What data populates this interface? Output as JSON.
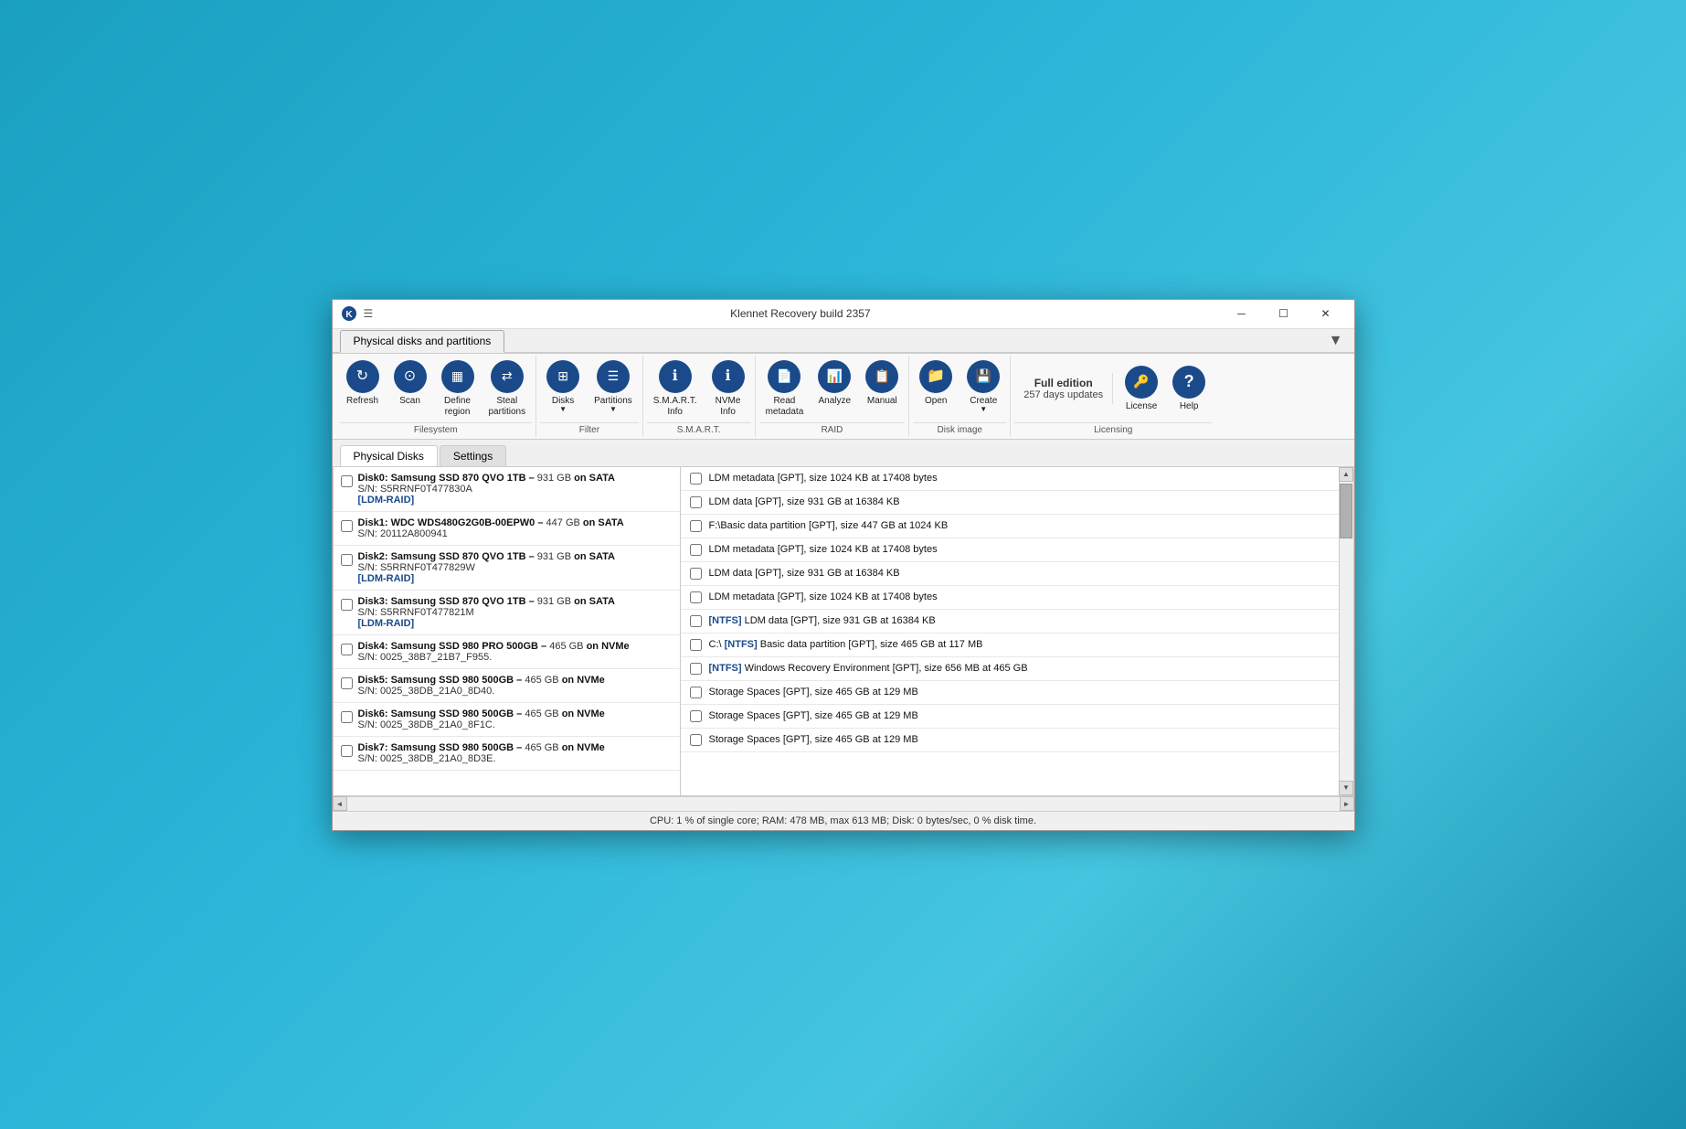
{
  "window": {
    "title": "Klennet Recovery build 2357",
    "tab_label": "Physical disks and partitions",
    "dropdown_arrow": "▼"
  },
  "ribbon": {
    "groups": [
      {
        "name": "filesystem",
        "label": "Filesystem",
        "buttons": [
          {
            "id": "refresh",
            "label": "Refresh",
            "icon": "↻",
            "sublabel": ""
          },
          {
            "id": "scan",
            "label": "Scan",
            "icon": "⊙",
            "sublabel": ""
          },
          {
            "id": "define-region",
            "label": "Define\nregion",
            "icon": "▦",
            "sublabel": ""
          },
          {
            "id": "steal-partitions",
            "label": "Steal\npartitions",
            "icon": "⇄",
            "sublabel": ""
          }
        ]
      },
      {
        "name": "filter",
        "label": "Filter",
        "buttons": [
          {
            "id": "disks",
            "label": "Disks",
            "icon": "⊞",
            "sublabel": "▼",
            "has_arrow": true
          },
          {
            "id": "partitions",
            "label": "Partitions",
            "icon": "☰",
            "sublabel": "▼",
            "has_arrow": true
          }
        ]
      },
      {
        "name": "smart",
        "label": "S.M.A.R.T.",
        "buttons": [
          {
            "id": "smart-info",
            "label": "S.M.A.R.T.\nInfo",
            "icon": "ℹ",
            "sublabel": ""
          },
          {
            "id": "nvme-info",
            "label": "NVMe\nInfo",
            "icon": "ℹ",
            "sublabel": ""
          }
        ]
      },
      {
        "name": "raid",
        "label": "RAID",
        "buttons": [
          {
            "id": "read-metadata",
            "label": "Read\nmetadata",
            "icon": "📄",
            "sublabel": ""
          },
          {
            "id": "analyze",
            "label": "Analyze",
            "icon": "📊",
            "sublabel": ""
          },
          {
            "id": "manual",
            "label": "Manual",
            "icon": "📋",
            "sublabel": ""
          }
        ]
      },
      {
        "name": "disk-image",
        "label": "Disk image",
        "buttons": [
          {
            "id": "open",
            "label": "Open",
            "icon": "📁",
            "sublabel": ""
          },
          {
            "id": "create",
            "label": "Create",
            "icon": "💾",
            "sublabel": "▼",
            "has_arrow": true
          }
        ]
      },
      {
        "name": "licensing",
        "label": "Licensing",
        "full_edition": "Full edition",
        "days_updates": "257 days updates",
        "buttons": [
          {
            "id": "license",
            "label": "License",
            "icon": "🔑",
            "sublabel": ""
          },
          {
            "id": "help",
            "label": "Help",
            "icon": "?",
            "sublabel": ""
          }
        ]
      }
    ]
  },
  "inner_tabs": [
    {
      "id": "physical-disks",
      "label": "Physical Disks",
      "active": true
    },
    {
      "id": "settings",
      "label": "Settings",
      "active": false
    }
  ],
  "disks": [
    {
      "id": "disk0",
      "name": "Disk0:",
      "model": "Samsung SSD 870 QVO 1TB",
      "size": "931 GB",
      "interface": "SATA",
      "serial": "S/N: S5RRNF0T477830A",
      "tag": "[LDM-RAID]",
      "partitions": [
        {
          "text": "LDM metadata [GPT], size 1024 KB at 17408 bytes",
          "ntfs": false
        },
        {
          "text": "LDM data [GPT], size 931 GB at 16384 KB",
          "ntfs": false
        }
      ]
    },
    {
      "id": "disk1",
      "name": "Disk1:",
      "model": "WDC WDS480G2G0B-00EPW0",
      "size": "447 GB",
      "interface": "SATA",
      "serial": "S/N: 20112A800941",
      "tag": "",
      "partitions": [
        {
          "text": "F:\\ Basic data partition [GPT], size 447 GB at 1024 KB",
          "ntfs": false,
          "prefix": "F:\\"
        }
      ]
    },
    {
      "id": "disk2",
      "name": "Disk2:",
      "model": "Samsung SSD 870 QVO 1TB",
      "size": "931 GB",
      "interface": "SATA",
      "serial": "S/N: S5RRNF0T477829W",
      "tag": "[LDM-RAID]",
      "partitions": [
        {
          "text": "LDM metadata [GPT], size 1024 KB at 17408 bytes",
          "ntfs": false
        },
        {
          "text": "LDM data [GPT], size 931 GB at 16384 KB",
          "ntfs": false
        }
      ]
    },
    {
      "id": "disk3",
      "name": "Disk3:",
      "model": "Samsung SSD 870 QVO 1TB",
      "size": "931 GB",
      "interface": "SATA",
      "serial": "S/N: S5RRNF0T477821M",
      "tag": "[LDM-RAID]",
      "partitions": [
        {
          "text": "LDM metadata [GPT], size 1024 KB at 17408 bytes",
          "ntfs": false
        },
        {
          "text": "[NTFS] LDM data [GPT], size 931 GB at 16384 KB",
          "ntfs": true
        }
      ]
    },
    {
      "id": "disk4",
      "name": "Disk4:",
      "model": "Samsung SSD 980 PRO 500GB",
      "size": "465 GB",
      "interface": "NVMe",
      "serial": "S/N: 0025_38B7_21B7_F955.",
      "tag": "",
      "partitions": [
        {
          "text": "C:\\ [NTFS] Basic data partition [GPT], size 465 GB at 117 MB",
          "ntfs": true
        },
        {
          "text": "[NTFS] Windows Recovery Environment [GPT], size 656 MB at 465 GB",
          "ntfs": true
        }
      ]
    },
    {
      "id": "disk5",
      "name": "Disk5:",
      "model": "Samsung SSD 980 500GB",
      "size": "465 GB",
      "interface": "NVMe",
      "serial": "S/N: 0025_38DB_21A0_8D40.",
      "tag": "",
      "partitions": [
        {
          "text": "Storage Spaces [GPT], size 465 GB at 129 MB",
          "ntfs": false
        }
      ]
    },
    {
      "id": "disk6",
      "name": "Disk6:",
      "model": "Samsung SSD 980 500GB",
      "size": "465 GB",
      "interface": "NVMe",
      "serial": "S/N: 0025_38DB_21A0_8F1C.",
      "tag": "",
      "partitions": [
        {
          "text": "Storage Spaces [GPT], size 465 GB at 129 MB",
          "ntfs": false
        }
      ]
    },
    {
      "id": "disk7",
      "name": "Disk7:",
      "model": "Samsung SSD 980 500GB",
      "size": "465 GB",
      "interface": "NVMe",
      "serial": "S/N: 0025_38DB_21A0_8D3E.",
      "tag": "",
      "partitions": [
        {
          "text": "Storage Spaces [GPT], size 465 GB at 129 MB",
          "ntfs": false
        }
      ]
    }
  ],
  "status_bar": "CPU: 1 % of single core; RAM: 478 MB, max 613 MB; Disk: 0 bytes/sec, 0 % disk time."
}
